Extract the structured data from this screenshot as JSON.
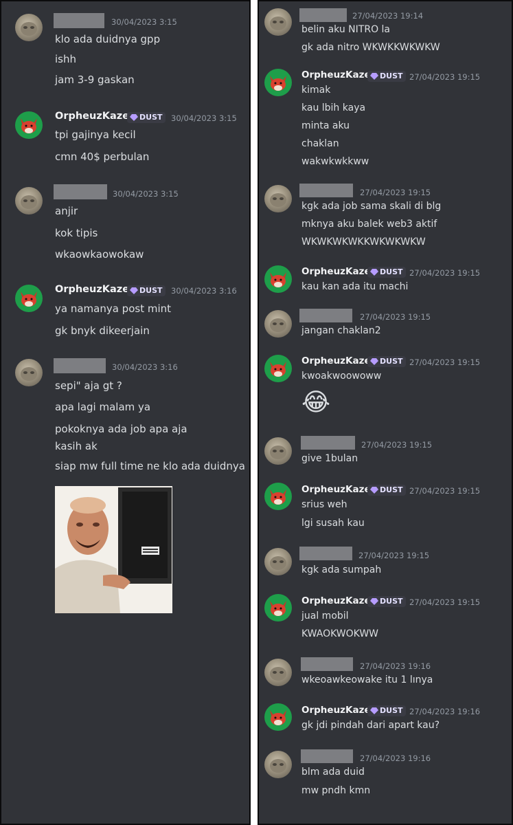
{
  "left_panel": {
    "messages": [
      {
        "user_hidden": true,
        "timestamp": "30/04/2023 3:15",
        "lines": [
          "klo ada duidnya gpp",
          "ishh",
          "jam 3-9 gaskan"
        ]
      },
      {
        "username": "OrpheuzKaze",
        "badge": "DUST",
        "timestamp": "30/04/2023 3:15",
        "lines": [
          "tpi gajinya kecil",
          "cmn 40$ perbulan"
        ]
      },
      {
        "user_hidden": true,
        "timestamp": "30/04/2023 3:15",
        "lines": [
          "anjir",
          "kok tipis",
          "wkaowkaowokaw"
        ]
      },
      {
        "username": "OrpheuzKaze",
        "badge": "DUST",
        "timestamp": "30/04/2023 3:16",
        "lines": [
          "ya namanya post mint",
          "gk bnyk dikeerjain"
        ]
      },
      {
        "user_hidden": true,
        "timestamp": "30/04/2023 3:16",
        "lines": [
          "sepi\" aja gt ?",
          "apa lagi malam ya",
          "pokoknya ada job apa aja",
          "kasih ak",
          "siap mw full time ne klo ada duidnya"
        ]
      }
    ]
  },
  "right_panel": {
    "messages": [
      {
        "user_hidden": true,
        "timestamp": "27/04/2023 19:14",
        "lines": [
          "belin aku NITRO la",
          "gk ada nitro WKWKKWKWKW"
        ]
      },
      {
        "username": "OrpheuzKaze",
        "badge": "DUST",
        "timestamp": "27/04/2023 19:15",
        "lines": [
          "kimak",
          "kau lbih kaya",
          "minta aku",
          "chaklan",
          "wakwkwkkww"
        ]
      },
      {
        "user_hidden": true,
        "timestamp": "27/04/2023 19:15",
        "lines": [
          "kgk ada job sama skali di blg",
          "mknya aku balek web3 aktif",
          "WKWKWKWKKWKWKWKW"
        ]
      },
      {
        "username": "OrpheuzKaze",
        "badge": "DUST",
        "timestamp": "27/04/2023 19:15",
        "lines": [
          "kau kan ada itu machi"
        ]
      },
      {
        "user_hidden": true,
        "timestamp": "27/04/2023 19:15",
        "lines": [
          "jangan chaklan2"
        ]
      },
      {
        "username": "OrpheuzKaze",
        "badge": "DUST",
        "timestamp": "27/04/2023 19:15",
        "lines": [
          "kwoakwoowoww",
          "😂"
        ]
      },
      {
        "user_hidden": true,
        "timestamp": "27/04/2023 19:15",
        "lines": [
          "give 1bulan"
        ]
      },
      {
        "username": "OrpheuzKaze",
        "badge": "DUST",
        "timestamp": "27/04/2023 19:15",
        "lines": [
          "srius weh",
          "lgi susah kau"
        ]
      },
      {
        "user_hidden": true,
        "timestamp": "27/04/2023 19:15",
        "lines": [
          "kgk ada sumpah"
        ]
      },
      {
        "username": "OrpheuzKaze",
        "badge": "DUST",
        "timestamp": "27/04/2023 19:15",
        "lines": [
          "jual mobil",
          "KWAOKWOKWW"
        ]
      },
      {
        "user_hidden": true,
        "timestamp": "27/04/2023 19:16",
        "lines": [
          "wkeoawkeowake itu 1 lınya"
        ]
      },
      {
        "username": "OrpheuzKaze",
        "badge": "DUST",
        "timestamp": "27/04/2023 19:16",
        "lines": [
          "gk jdi pindah dari apart kau?"
        ]
      },
      {
        "user_hidden": true,
        "timestamp": "27/04/2023 19:16",
        "lines": [
          "blm ada duid",
          "mw pndh kmn"
        ]
      }
    ]
  },
  "colors": {
    "background": "#313338",
    "text": "#dbdee1",
    "timestamp": "#949ba4",
    "username": "#f2f3f5",
    "badge_bg": "#3a3b44",
    "badge_gem": "#b69cff",
    "fox_bg": "#1e9e4a",
    "redacted": "#7d7e82"
  },
  "icons": {
    "badge": "gem-icon",
    "avatar_user": "stone-cat-avatar",
    "avatar_orpheuz": "red-fox-avatar",
    "image": "laughing-man-meme"
  }
}
